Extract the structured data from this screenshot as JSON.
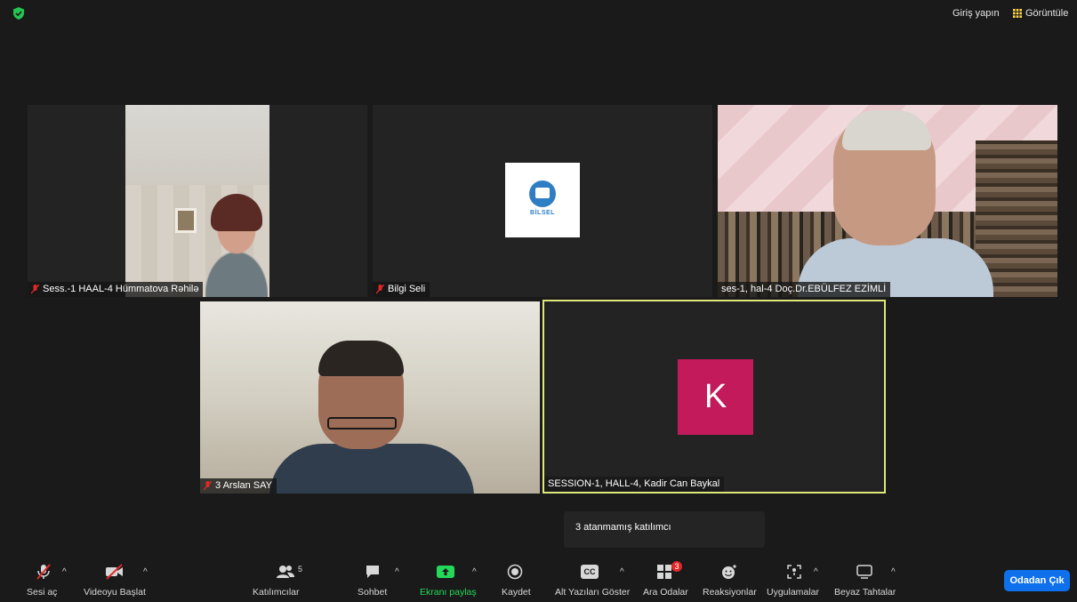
{
  "top": {
    "signin": "Giriş yapın",
    "view": "Görüntüle"
  },
  "tiles": [
    {
      "name": "Sess.-1  HAAL-4 Hümmatova Rəhilə",
      "muted": true
    },
    {
      "name": "Bilgi Seli",
      "muted": true,
      "logo_text": "BİLSEL"
    },
    {
      "name": "ses-1, hal-4 Doç.Dr.EBÜLFEZ EZİMLİ",
      "muted": false
    },
    {
      "name": "3 Arslan SAY",
      "muted": true
    },
    {
      "name": "SESSION-1, HALL-4, Kadir Can Baykal",
      "muted": false,
      "avatar_letter": "K"
    }
  ],
  "tooltip": "3 atanmamış katılımcı",
  "toolbar": {
    "unmute": "Sesi aç",
    "video": "Videoyu Başlat",
    "participants": "Katılımcılar",
    "participants_count": "5",
    "chat": "Sohbet",
    "share": "Ekranı paylaş",
    "record": "Kaydet",
    "captions": "Alt Yazıları Göster",
    "captions_icon": "CC",
    "breakout": "Ara Odalar",
    "breakout_badge": "3",
    "reactions": "Reaksiyonlar",
    "apps": "Uygulamalar",
    "whiteboard": "Beyaz Tahtalar",
    "leave": "Odadan Çık"
  },
  "colors": {
    "accent": "#0e71eb",
    "share": "#23d959",
    "active_speaker": "#dfe87a",
    "avatar": "#c21a5a"
  }
}
